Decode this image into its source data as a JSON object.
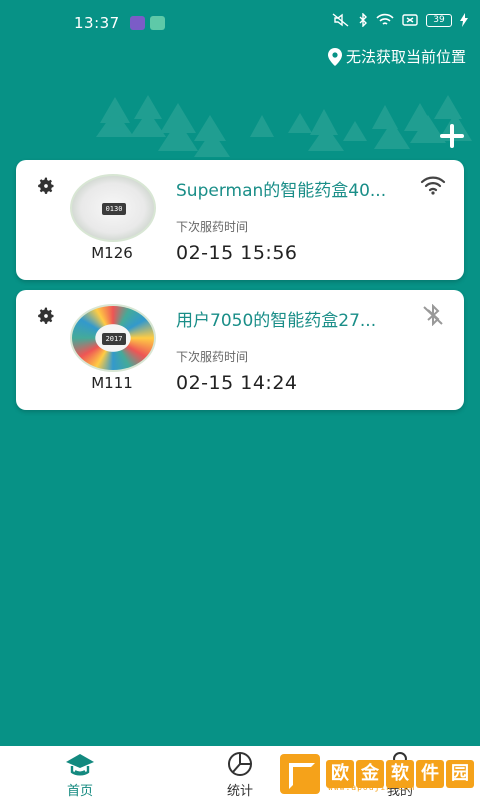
{
  "status_bar": {
    "time": "13:37",
    "battery": "39"
  },
  "header": {
    "location_text": "无法获取当前位置",
    "add_icon": "plus-icon"
  },
  "devices": [
    {
      "name": "Superman的智能药盒40...",
      "model": "M126",
      "next_label": "下次服药时间",
      "next_time": "02-15 15:56",
      "connection": "wifi",
      "display": "0130"
    },
    {
      "name": "用户7050的智能药盒27...",
      "model": "M111",
      "next_label": "下次服药时间",
      "next_time": "02-15 14:24",
      "connection": "bluetooth-off",
      "display": "2017"
    }
  ],
  "bottom_nav": {
    "items": [
      {
        "label": "首页",
        "icon": "home-icon",
        "active": true
      },
      {
        "label": "统计",
        "icon": "pie-chart-icon",
        "active": false
      },
      {
        "label": "我的",
        "icon": "user-icon",
        "active": false
      }
    ]
  },
  "watermark": {
    "text": "欧金软件园",
    "url": "www.apoujin.com"
  },
  "colors": {
    "background": "#079286",
    "accent": "#1a8e88",
    "card": "#ffffff",
    "watermark": "#f5a21a"
  }
}
